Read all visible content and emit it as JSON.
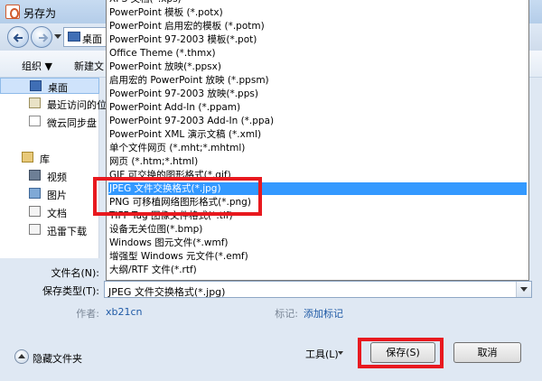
{
  "window": {
    "title": "另存为"
  },
  "address": {
    "current": "桌面"
  },
  "toolbar": {
    "organize": "组织 ▼",
    "new_folder": "新建文"
  },
  "sidebar": {
    "items": [
      {
        "label": "桌面",
        "icon": "desktop-icon"
      },
      {
        "label": "最近访问的位",
        "icon": "recent-places-icon"
      },
      {
        "label": "微云同步盘",
        "icon": "weiyun-icon"
      },
      {
        "label": "库",
        "icon": "library-icon"
      },
      {
        "label": "视频",
        "icon": "video-icon"
      },
      {
        "label": "图片",
        "icon": "picture-icon"
      },
      {
        "label": "文档",
        "icon": "document-icon"
      },
      {
        "label": "迅雷下载",
        "icon": "thunder-download-icon"
      }
    ]
  },
  "filetypes": [
    "XPS 文档(*.xps)",
    "PowerPoint 模板 (*.potx)",
    "PowerPoint 启用宏的模板 (*.potm)",
    "PowerPoint 97-2003 模板(*.pot)",
    "Office Theme (*.thmx)",
    "PowerPoint 放映(*.ppsx)",
    "启用宏的 PowerPoint 放映 (*.ppsm)",
    "PowerPoint 97-2003 放映(*.pps)",
    "PowerPoint Add-In (*.ppam)",
    "PowerPoint 97-2003 Add-In (*.ppa)",
    "PowerPoint XML 演示文稿 (*.xml)",
    "单个文件网页 (*.mht;*.mhtml)",
    "网页 (*.htm;*.html)",
    "GIF 可交换的图形格式(*.gif)",
    "JPEG 文件交换格式(*.jpg)",
    "PNG 可移植网络图形格式(*.png)",
    "TIFF Tag 图像文件格式(*.tif)",
    "设备无关位图(*.bmp)",
    "Windows 图元文件(*.wmf)",
    "增强型 Windows 元文件(*.emf)",
    "大纲/RTF 文件(*.rtf)"
  ],
  "selected_index": 14,
  "form": {
    "filename_label": "文件名(N):",
    "savetype_label": "保存类型(T):",
    "savetype_value": "JPEG 文件交换格式(*.jpg)",
    "author_label": "作者:",
    "author_value": "xb21cn",
    "tags_label": "标记:",
    "tags_value": "添加标记"
  },
  "buttons": {
    "tools": "工具(L)",
    "save": "保存(S)",
    "cancel": "取消",
    "hide_folders": "隐藏文件夹"
  },
  "colors": {
    "highlight": "#3399ff",
    "annotation": "#e8191f",
    "link": "#1f5aa6"
  }
}
